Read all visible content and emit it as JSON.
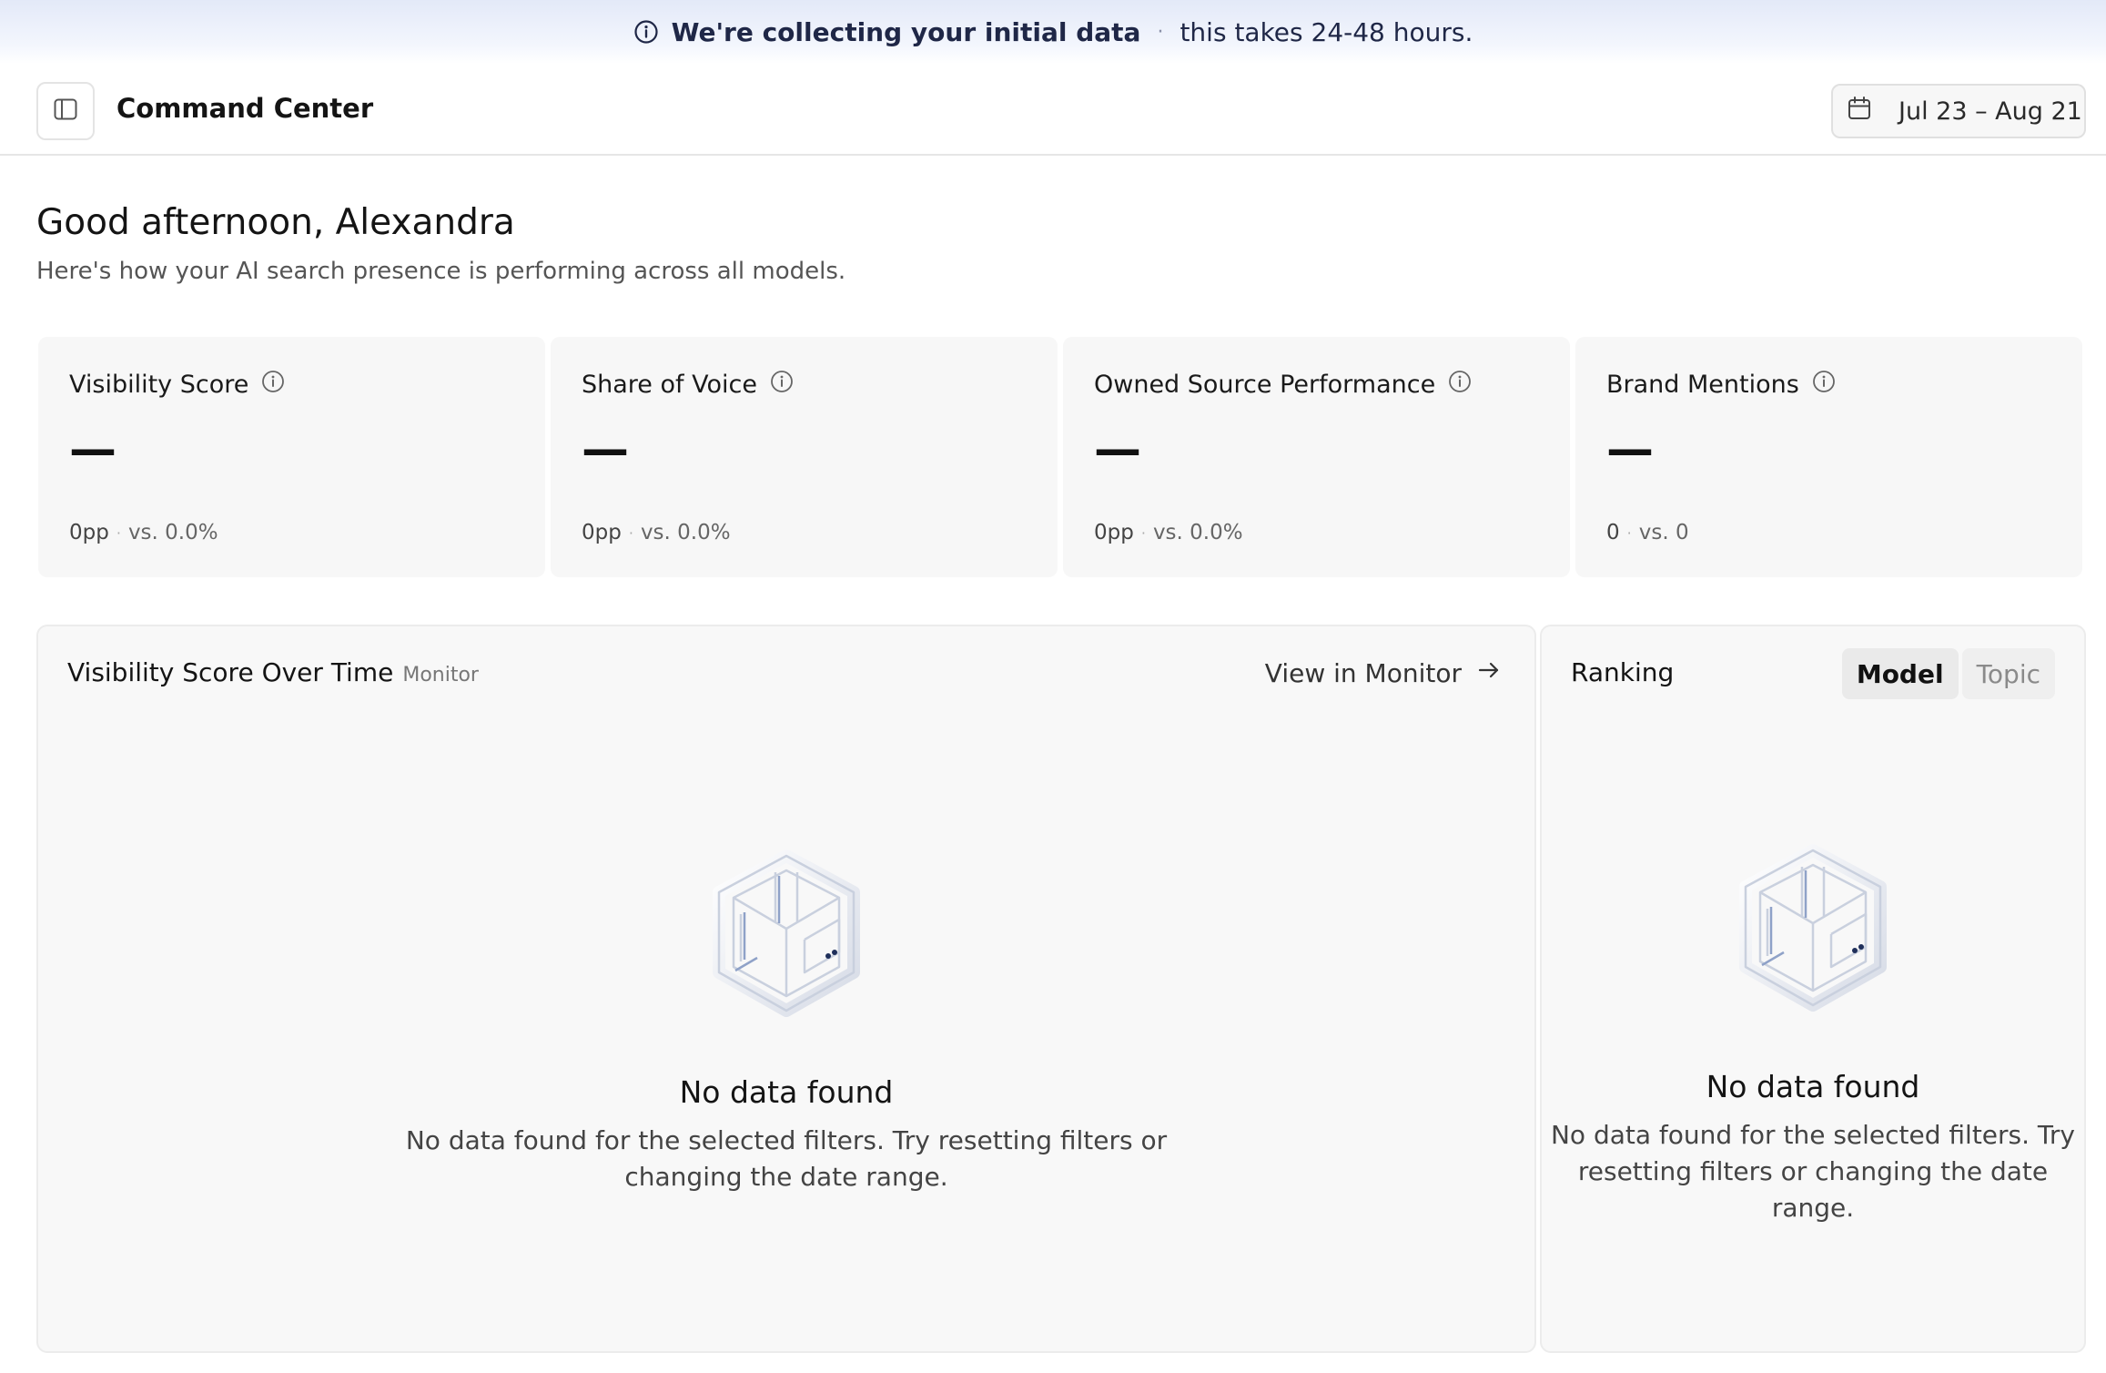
{
  "banner": {
    "bold_text": "We're collecting your initial data",
    "separator": "·",
    "detail_text": "this takes 24-48 hours."
  },
  "header": {
    "title": "Command Center",
    "date_range": "Jul 23 – Aug 21"
  },
  "greeting": {
    "title": "Good afternoon, Alexandra",
    "subtitle": "Here's how your AI search presence is performing across all models."
  },
  "kpis": [
    {
      "label": "Visibility Score",
      "value": "—",
      "delta": "0pp",
      "comparison": "vs. 0.0%"
    },
    {
      "label": "Share of Voice",
      "value": "—",
      "delta": "0pp",
      "comparison": "vs. 0.0%"
    },
    {
      "label": "Owned Source Performance",
      "value": "—",
      "delta": "0pp",
      "comparison": "vs. 0.0%"
    },
    {
      "label": "Brand Mentions",
      "value": "—",
      "delta": "0",
      "comparison": "vs. 0"
    }
  ],
  "visibility_panel": {
    "title": "Visibility Score Over Time",
    "tag": "Monitor",
    "link_label": "View in Monitor",
    "empty_title": "No data found",
    "empty_line1": "No data found for the selected filters. Try resetting filters or",
    "empty_line2": "changing the date range."
  },
  "ranking_panel": {
    "title": "Ranking",
    "tabs": [
      "Model",
      "Topic"
    ],
    "active_tab": "Model",
    "empty_title": "No data found",
    "empty_line1": "No data found for the selected filters. Try",
    "empty_line2": "resetting filters or changing the date",
    "empty_line3": "range."
  },
  "icons": {
    "banner": "info-icon",
    "sidebar_toggle": "sidebar-toggle-icon",
    "date": "calendar-icon",
    "kpi_info": "info-icon",
    "link": "arrow-right-icon",
    "empty_state": "wireframe-cube-icon"
  }
}
